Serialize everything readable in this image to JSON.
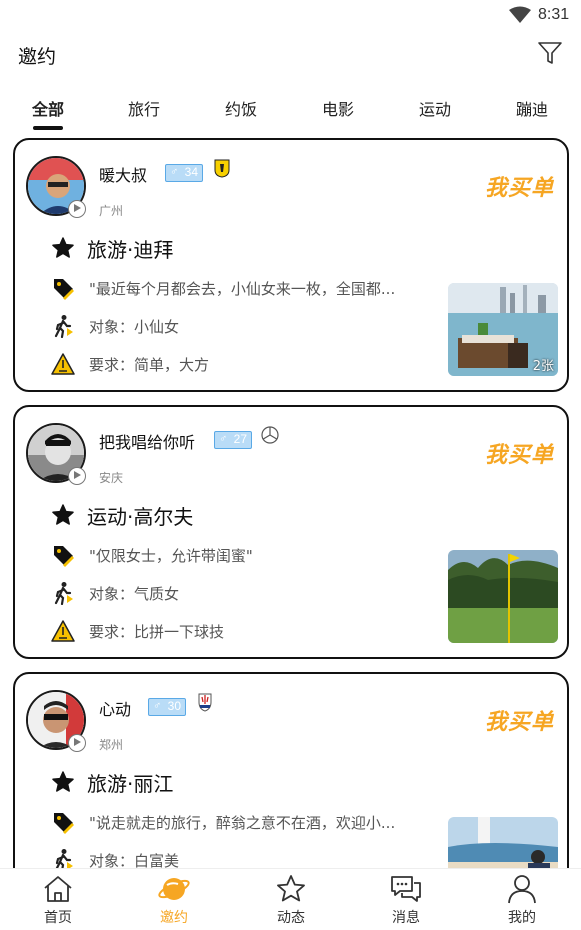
{
  "status_bar": {
    "time": "8:31"
  },
  "header": {
    "title": "邀约"
  },
  "tabs": [
    {
      "label": "全部",
      "active": true
    },
    {
      "label": "旅行"
    },
    {
      "label": "约饭"
    },
    {
      "label": "电影"
    },
    {
      "label": "运动"
    },
    {
      "label": "蹦迪"
    }
  ],
  "cards": [
    {
      "name": "暖大叔",
      "age": "34",
      "car_icon": "ferrari-icon",
      "city": "广州",
      "buy_label": "我买单",
      "activity": "旅游·迪拜",
      "quote": "\"最近每个月都会去，小仙女来一枚，全国都...",
      "target": "对象：小仙女",
      "requirement": "要求：简单，大方",
      "photo_count": "2张"
    },
    {
      "name": "把我唱给你听",
      "age": "27",
      "car_icon": "mercedes-icon",
      "city": "安庆",
      "buy_label": "我买单",
      "activity": "运动·高尔夫",
      "quote": "\"仅限女士，允许带闺蜜\"",
      "target": "对象：气质女",
      "requirement": "要求：比拼一下球技",
      "photo_count": ""
    },
    {
      "name": "心动",
      "age": "30",
      "car_icon": "maserati-icon",
      "city": "郑州",
      "buy_label": "我买单",
      "activity": "旅游·丽江",
      "quote": "\"说走就走的旅行，醉翁之意不在酒，欢迎小...",
      "target": "对象：白富美",
      "requirement": "",
      "photo_count": ""
    }
  ],
  "bottom_nav": [
    {
      "label": "首页",
      "icon": "home-icon"
    },
    {
      "label": "邀约",
      "icon": "planet-icon",
      "active": true
    },
    {
      "label": "动态",
      "icon": "star-icon"
    },
    {
      "label": "消息",
      "icon": "chat-icon"
    },
    {
      "label": "我的",
      "icon": "person-icon"
    }
  ],
  "colors": {
    "accent": "#f6a623",
    "age_badge": "#b9dcf7",
    "border": "#111111"
  }
}
